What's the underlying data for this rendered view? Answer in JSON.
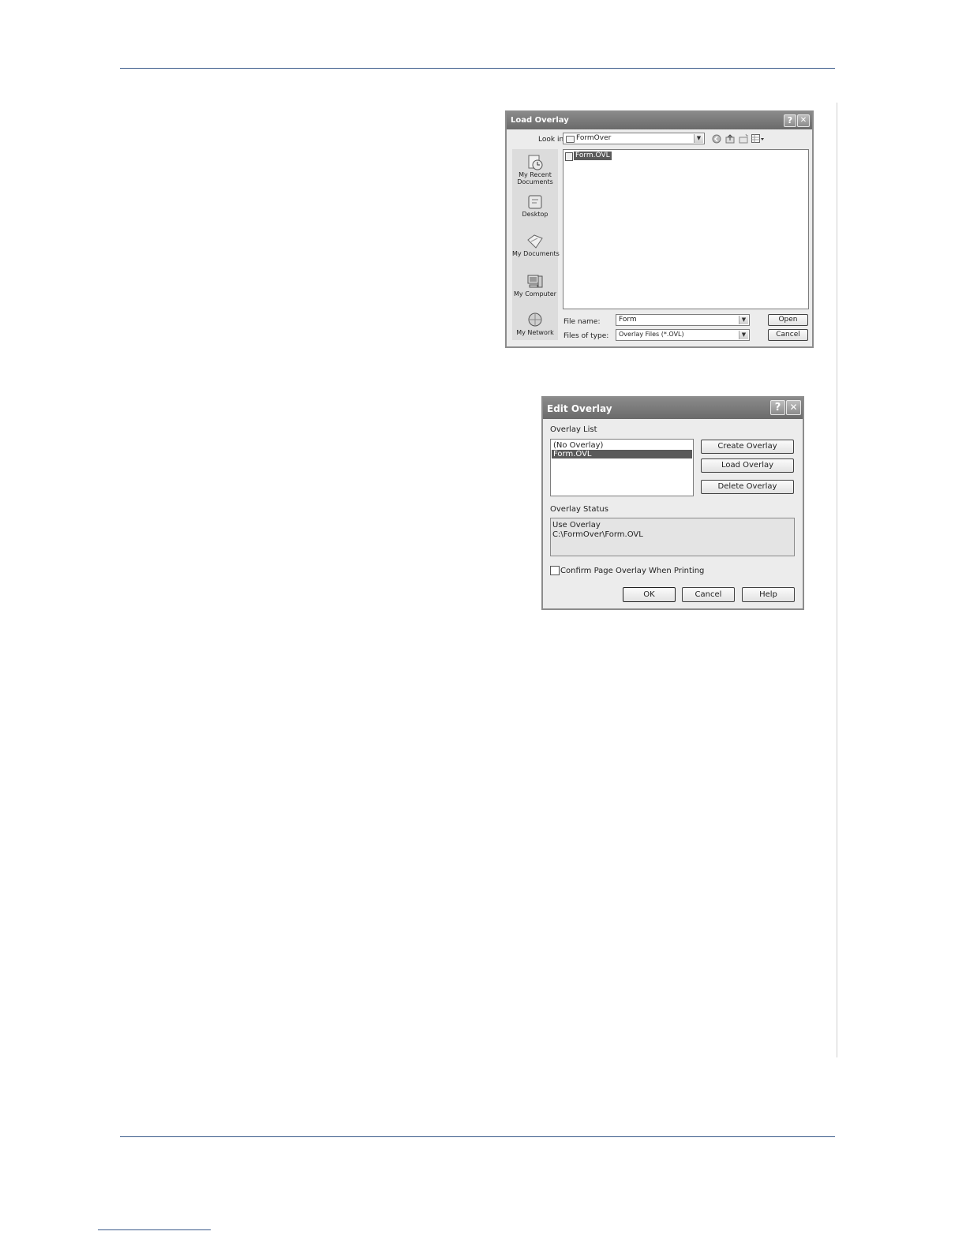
{
  "load_overlay": {
    "title": "Load Overlay",
    "help_glyph": "?",
    "close_glyph": "✕",
    "look_in_label": "Look in:",
    "look_in_value": "FormOver",
    "places": [
      {
        "label": "My Recent Documents",
        "icon": "recent-documents-icon"
      },
      {
        "label": "Desktop",
        "icon": "desktop-icon"
      },
      {
        "label": "My Documents",
        "icon": "my-documents-icon"
      },
      {
        "label": "My Computer",
        "icon": "my-computer-icon"
      },
      {
        "label": "My Network",
        "icon": "my-network-icon"
      }
    ],
    "files": [
      "Form.OVL"
    ],
    "file_name_label": "File name:",
    "file_name_value": "Form",
    "files_of_type_label": "Files of type:",
    "files_of_type_value": "Overlay Files (*.OVL)",
    "open_label": "Open",
    "cancel_label": "Cancel"
  },
  "edit_overlay": {
    "title": "Edit Overlay",
    "help_glyph": "?",
    "close_glyph": "✕",
    "overlay_list_label": "Overlay List",
    "overlay_items": [
      "(No Overlay)",
      "Form.OVL"
    ],
    "selected_item": "Form.OVL",
    "create_label": "Create Overlay",
    "load_label": "Load Overlay",
    "delete_label": "Delete Overlay",
    "status_label": "Overlay Status",
    "status_line1": "Use Overlay",
    "status_line2": "C:\\FormOver\\Form.OVL",
    "confirm_label": "Confirm Page Overlay When Printing",
    "confirm_checked": false,
    "ok_label": "OK",
    "cancel_label": "Cancel",
    "help_label": "Help"
  }
}
